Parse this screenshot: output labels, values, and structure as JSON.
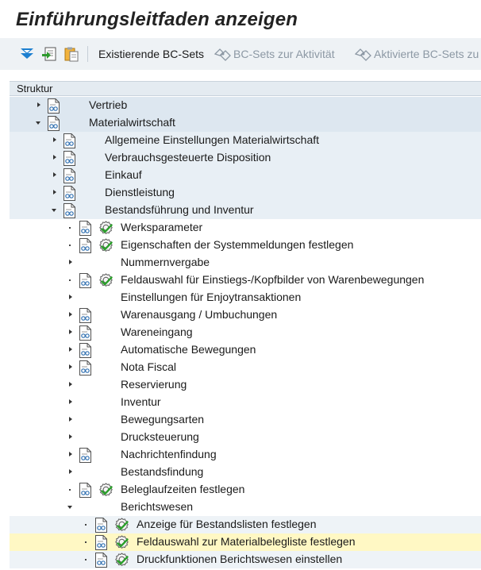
{
  "header": {
    "title": "Einführungsleitfaden anzeigen"
  },
  "toolbar": {
    "existing_bc_sets": "Existierende BC-Sets",
    "bc_sets_activity": "BC-Sets zur Aktivität",
    "activated_bc_sets": "Aktivierte BC-Sets zu",
    "disabled_color": "#8c98a4"
  },
  "structure": {
    "header": "Struktur",
    "items": [
      {
        "label": "Vertrieb",
        "level": 1,
        "toggle": "collapsed",
        "doc": true,
        "exec": false,
        "bg": "#dde7f0"
      },
      {
        "label": "Materialwirtschaft",
        "level": 1,
        "toggle": "expanded",
        "doc": true,
        "exec": false,
        "bg": "#dde7f0"
      },
      {
        "label": "Allgemeine Einstellungen Materialwirtschaft",
        "level": 2,
        "toggle": "collapsed",
        "doc": true,
        "exec": false,
        "bg": "#e8eff5"
      },
      {
        "label": "Verbrauchsgesteuerte Disposition",
        "level": 2,
        "toggle": "collapsed",
        "doc": true,
        "exec": false,
        "bg": "#e8eff5"
      },
      {
        "label": "Einkauf",
        "level": 2,
        "toggle": "collapsed",
        "doc": true,
        "exec": false,
        "bg": "#e8eff5"
      },
      {
        "label": "Dienstleistung",
        "level": 2,
        "toggle": "collapsed",
        "doc": true,
        "exec": false,
        "bg": "#e8eff5"
      },
      {
        "label": "Bestandsführung und Inventur",
        "level": 2,
        "toggle": "expanded",
        "doc": true,
        "exec": false,
        "bg": "#e8eff5"
      },
      {
        "label": "Werksparameter",
        "level": 3,
        "toggle": "leaf",
        "doc": true,
        "exec": true,
        "bg": "#ffffff"
      },
      {
        "label": "Eigenschaften der Systemmeldungen festlegen",
        "level": 3,
        "toggle": "leaf",
        "doc": true,
        "exec": true,
        "bg": "#ffffff"
      },
      {
        "label": "Nummernvergabe",
        "level": 3,
        "toggle": "collapsed",
        "doc": false,
        "exec": false,
        "bg": "#ffffff"
      },
      {
        "label": "Feldauswahl für Einstiegs-/Kopfbilder von Warenbewegungen",
        "level": 3,
        "toggle": "leaf",
        "doc": true,
        "exec": true,
        "bg": "#ffffff"
      },
      {
        "label": "Einstellungen für Enjoytransaktionen",
        "level": 3,
        "toggle": "collapsed",
        "doc": false,
        "exec": false,
        "bg": "#ffffff"
      },
      {
        "label": "Warenausgang / Umbuchungen",
        "level": 3,
        "toggle": "collapsed",
        "doc": true,
        "exec": false,
        "bg": "#ffffff"
      },
      {
        "label": "Wareneingang",
        "level": 3,
        "toggle": "collapsed",
        "doc": true,
        "exec": false,
        "bg": "#ffffff"
      },
      {
        "label": "Automatische Bewegungen",
        "level": 3,
        "toggle": "collapsed",
        "doc": true,
        "exec": false,
        "bg": "#ffffff"
      },
      {
        "label": "Nota Fiscal",
        "level": 3,
        "toggle": "collapsed",
        "doc": true,
        "exec": false,
        "bg": "#ffffff"
      },
      {
        "label": "Reservierung",
        "level": 3,
        "toggle": "collapsed",
        "doc": false,
        "exec": false,
        "bg": "#ffffff"
      },
      {
        "label": "Inventur",
        "level": 3,
        "toggle": "collapsed",
        "doc": false,
        "exec": false,
        "bg": "#ffffff"
      },
      {
        "label": "Bewegungsarten",
        "level": 3,
        "toggle": "collapsed",
        "doc": false,
        "exec": false,
        "bg": "#ffffff"
      },
      {
        "label": "Drucksteuerung",
        "level": 3,
        "toggle": "collapsed",
        "doc": false,
        "exec": false,
        "bg": "#ffffff"
      },
      {
        "label": "Nachrichtenfindung",
        "level": 3,
        "toggle": "collapsed",
        "doc": true,
        "exec": false,
        "bg": "#ffffff"
      },
      {
        "label": "Bestandsfindung",
        "level": 3,
        "toggle": "collapsed",
        "doc": false,
        "exec": false,
        "bg": "#ffffff"
      },
      {
        "label": "Beleglaufzeiten festlegen",
        "level": 3,
        "toggle": "leaf",
        "doc": true,
        "exec": true,
        "bg": "#ffffff"
      },
      {
        "label": "Berichtswesen",
        "level": 3,
        "toggle": "expanded",
        "doc": false,
        "exec": false,
        "bg": "#ffffff"
      },
      {
        "label": "Anzeige für Bestandslisten festlegen",
        "level": 4,
        "toggle": "leaf",
        "doc": true,
        "exec": true,
        "bg": "#eef3f7"
      },
      {
        "label": "Feldauswahl zur Materialbelegliste festlegen",
        "level": 4,
        "toggle": "leaf",
        "doc": true,
        "exec": true,
        "bg": "#fff8c4",
        "selected": true
      },
      {
        "label": "Druckfunktionen Berichtswesen einstellen",
        "level": 4,
        "toggle": "leaf",
        "doc": true,
        "exec": true,
        "bg": "#eef3f7"
      }
    ]
  }
}
